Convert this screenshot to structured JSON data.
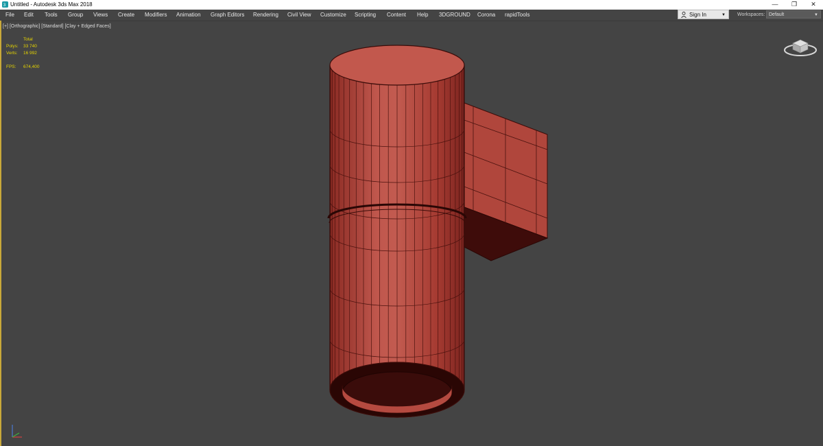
{
  "window": {
    "title": "Untitled - Autodesk 3ds Max 2018",
    "minimize_glyph": "—",
    "maximize_glyph": "❐",
    "close_glyph": "✕"
  },
  "menu": [
    "File",
    "Edit",
    "Tools",
    "Group",
    "Views",
    "Create",
    "Modifiers",
    "Animation",
    "Graph Editors",
    "Rendering",
    "Civil View",
    "Customize",
    "Scripting",
    "Content",
    "Help",
    "3DGROUND",
    "Corona",
    "rapidTools"
  ],
  "account": {
    "sign_in_label": "Sign In",
    "dropdown_glyph": "▼"
  },
  "workspaces": {
    "label": "Workspaces:",
    "value": "Default",
    "dropdown_glyph": "▼"
  },
  "viewport": {
    "labels": [
      "[+]",
      "[Orthographic]",
      "[Standard]",
      "[Clay + Edged Faces]"
    ],
    "stats": {
      "header": "Total",
      "polys_label": "Polys:",
      "polys_value": "33 740",
      "verts_label": "Verts:",
      "verts_value": "16 992",
      "fps_label": "FPS:",
      "fps_value": "674,400"
    },
    "model_color": "#b5463d",
    "model_shadow_color": "#3e0c0a"
  }
}
